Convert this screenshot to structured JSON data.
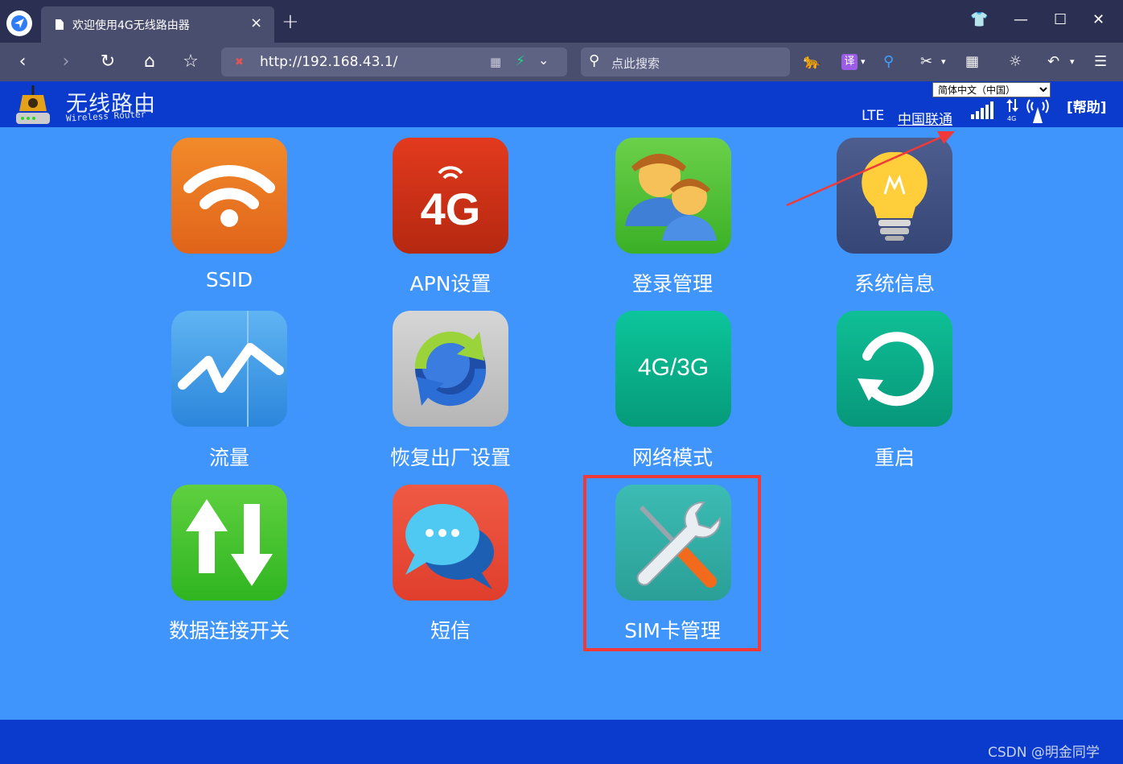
{
  "browser": {
    "tab_title": "欢迎使用4G无线路由器",
    "tab_close": "×",
    "new_tab": "+",
    "url": "http://192.168.43.1/",
    "search_placeholder": "点此搜索",
    "translate_label": "译",
    "window_controls": {
      "shirt": "👕",
      "minimize": "—",
      "maximize": "☐",
      "close": "✕"
    }
  },
  "router": {
    "brand_cn": "无线路由",
    "brand_en": "Wireless Router",
    "language": "简体中文（中国）",
    "network_type": "LTE",
    "carrier": "中国联通",
    "data_label": "4G",
    "help": "[帮助]",
    "accent_color": "#0a3bcc",
    "background_color": "#3f95fb"
  },
  "tiles": [
    {
      "label": "SSID",
      "icon": "wifi-icon"
    },
    {
      "label": "APN设置",
      "icon": "4g-icon",
      "text": "4G"
    },
    {
      "label": "登录管理",
      "icon": "users-icon"
    },
    {
      "label": "系统信息",
      "icon": "lightbulb-icon"
    },
    {
      "label": "流量",
      "icon": "traffic-chart-icon"
    },
    {
      "label": "恢复出厂设置",
      "icon": "restore-icon"
    },
    {
      "label": "网络模式",
      "icon": "network-mode-icon",
      "text": "4G/3G"
    },
    {
      "label": "重启",
      "icon": "reboot-icon"
    },
    {
      "label": "数据连接开关",
      "icon": "data-switch-icon"
    },
    {
      "label": "短信",
      "icon": "sms-icon"
    },
    {
      "label": "SIM卡管理",
      "icon": "tools-icon"
    }
  ],
  "footer": {
    "watermark": "CSDN @明金同学"
  }
}
